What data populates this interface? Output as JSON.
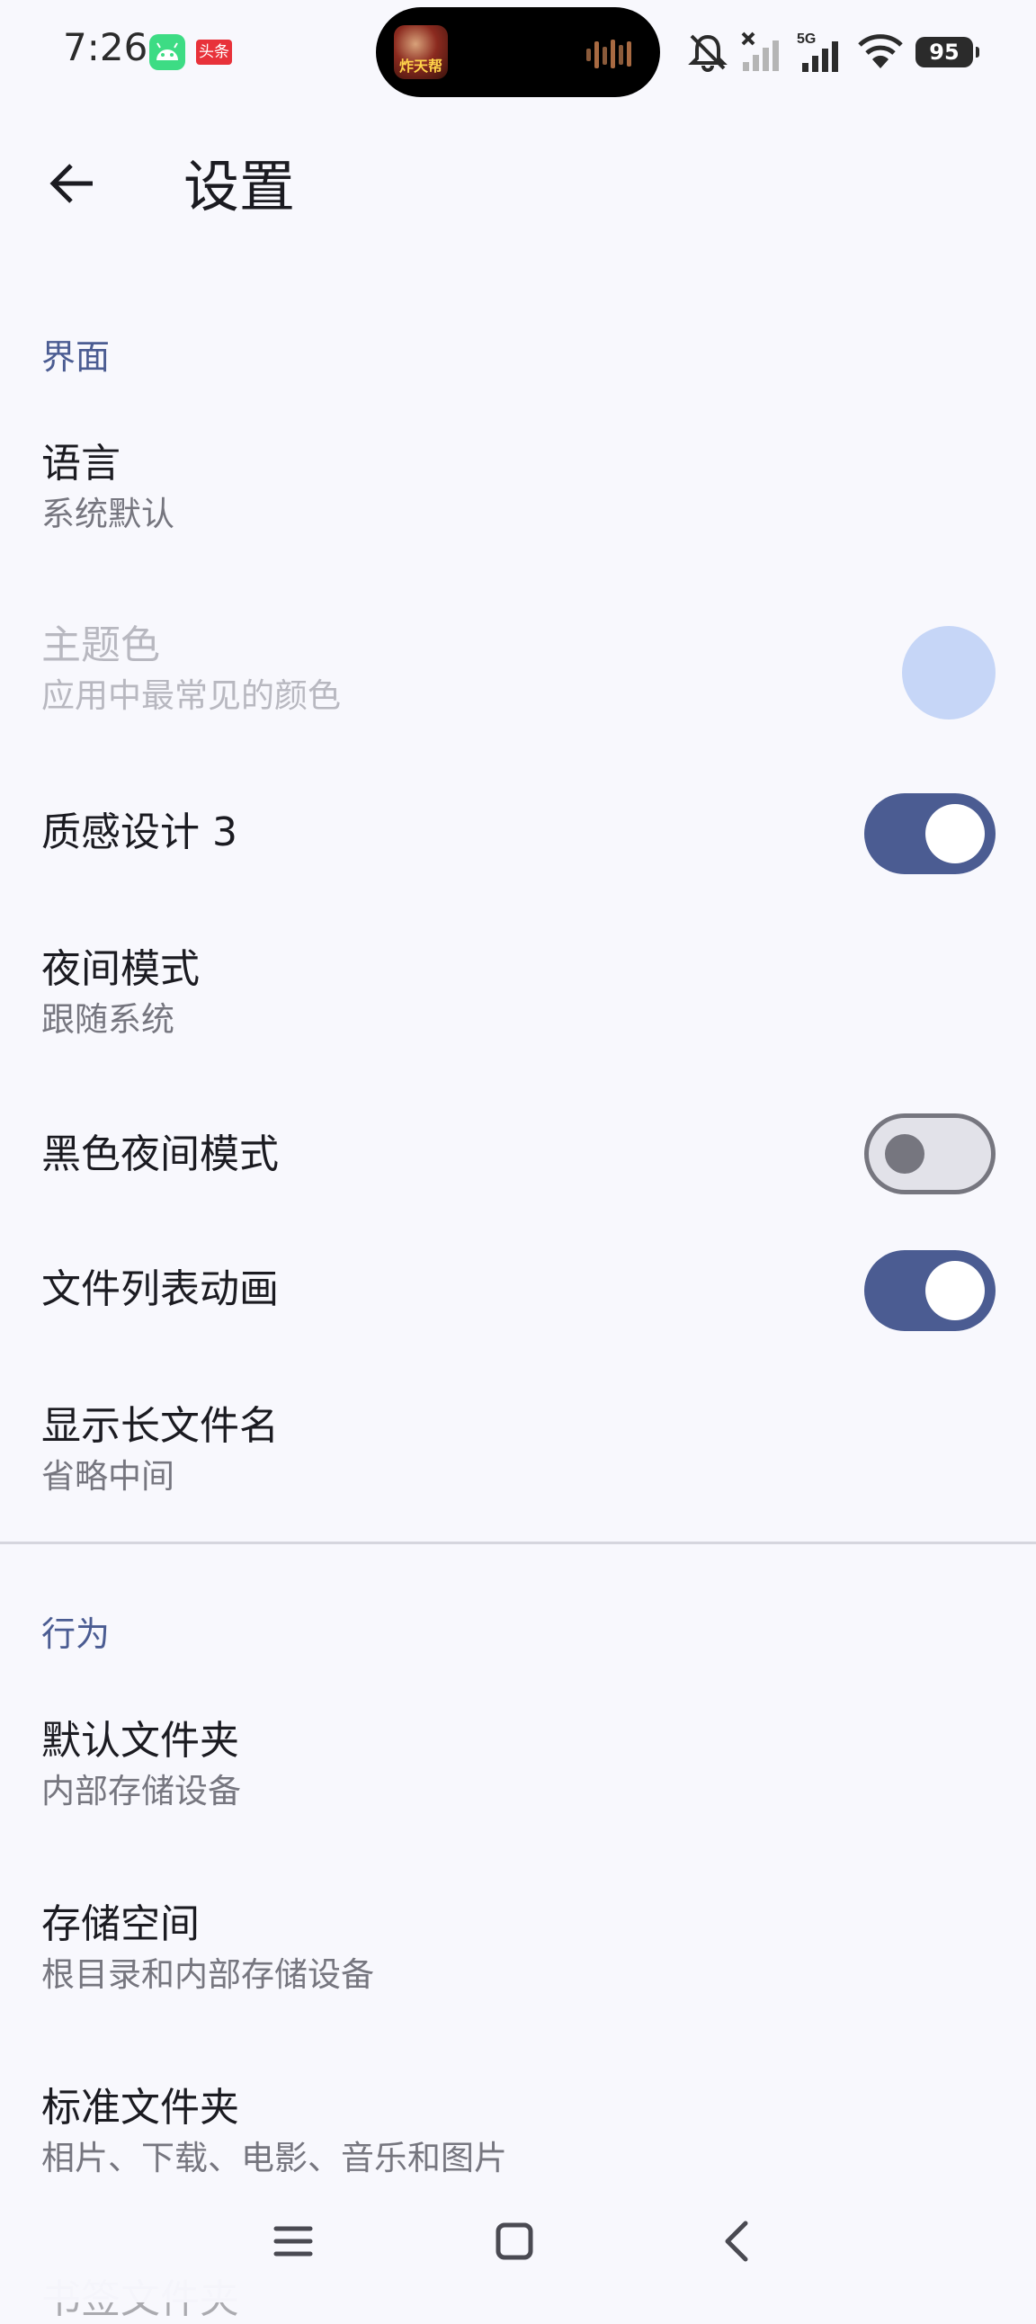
{
  "status_bar": {
    "time": "7:26",
    "notification_icons": [
      "android-app-icon",
      "toutiao-app-icon"
    ],
    "toutiao_label": "头条",
    "media_art_label": "炸天帮",
    "system_icons": [
      "mute-icon",
      "signal-off-icon",
      "signal-5g-icon",
      "wifi-icon"
    ],
    "network_label": "5G",
    "battery": "95"
  },
  "app_bar": {
    "back_icon": "arrow-left-icon",
    "title": "设置"
  },
  "sections": {
    "interface": {
      "header": "界面",
      "language": {
        "title": "语言",
        "subtitle": "系统默认"
      },
      "theme_color": {
        "title": "主题色",
        "subtitle": "应用中最常见的颜色",
        "color": "#c6d6f7",
        "enabled": false
      },
      "material3": {
        "title": "质感设计 3",
        "checked": true
      },
      "night_mode": {
        "title": "夜间模式",
        "subtitle": "跟随系统"
      },
      "black_night_mode": {
        "title": "黑色夜间模式",
        "checked": false
      },
      "file_list_animation": {
        "title": "文件列表动画",
        "checked": true
      },
      "long_file_name": {
        "title": "显示长文件名",
        "subtitle": "省略中间"
      }
    },
    "behavior": {
      "header": "行为",
      "default_folder": {
        "title": "默认文件夹",
        "subtitle": "内部存储设备"
      },
      "storage": {
        "title": "存储空间",
        "subtitle": "根目录和内部存储设备"
      },
      "standard_folders": {
        "title": "标准文件夹",
        "subtitle": "相片、下载、电影、音乐和图片"
      },
      "bookmark_folders": {
        "title": "书签文件夹"
      }
    }
  },
  "colors": {
    "accent": "#4b5c92",
    "background": "#f8f8fd",
    "primary_text": "#1b1b21",
    "secondary_text": "#76767f"
  },
  "nav_bar": {
    "icons": [
      "menu-icon",
      "home-icon",
      "back-icon"
    ]
  }
}
